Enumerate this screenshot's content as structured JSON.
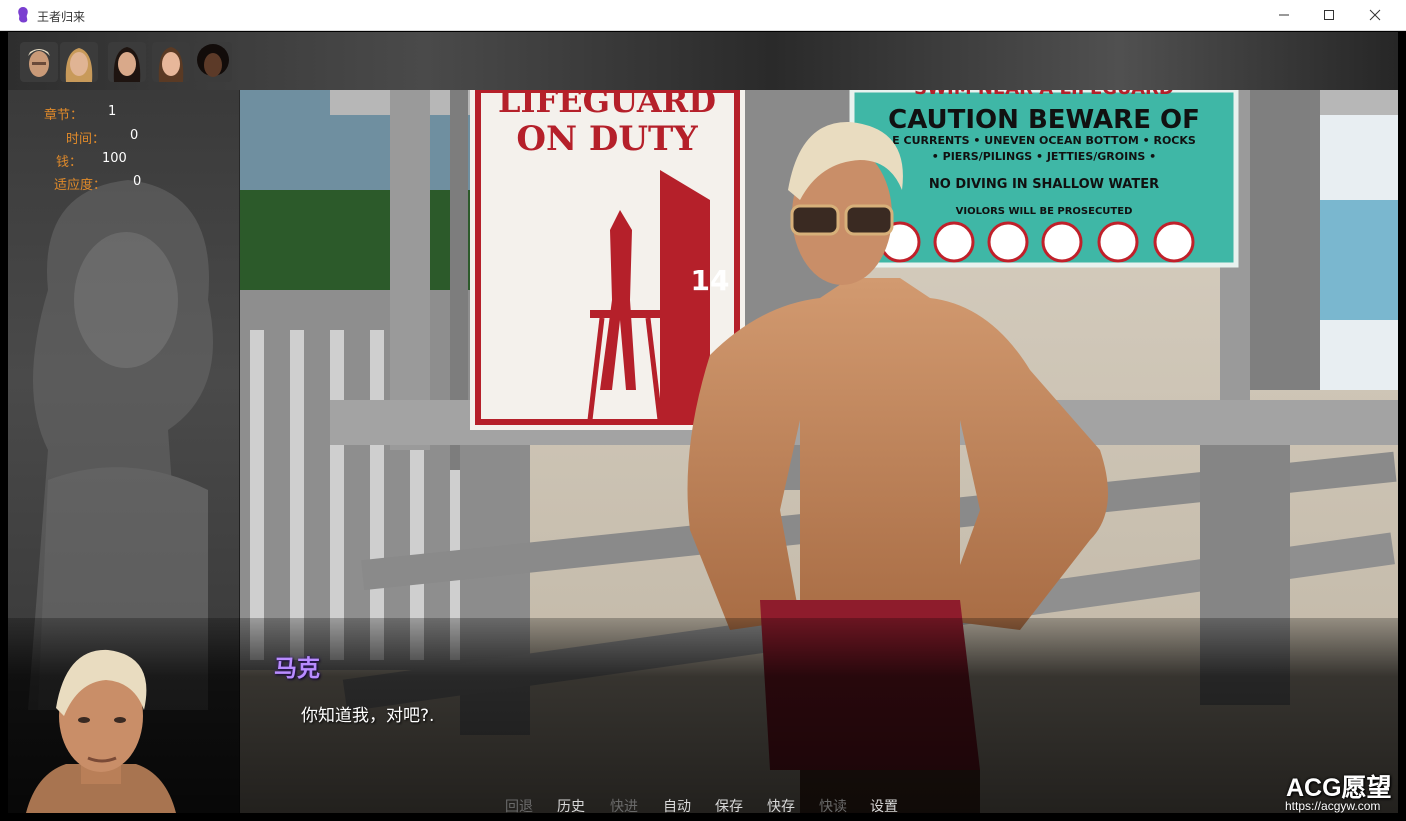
{
  "window": {
    "title": "王者归来"
  },
  "stats": [
    {
      "label": "章节：",
      "value": "1"
    },
    {
      "label": "时间：",
      "value": "0"
    },
    {
      "label": "钱：",
      "value": "100"
    },
    {
      "label": "适应度：",
      "value": "0"
    }
  ],
  "dialogue": {
    "speaker": "马克",
    "text": "你知道我，对吧?."
  },
  "quick_menu": [
    {
      "label": "回退",
      "enabled": false
    },
    {
      "label": "历史",
      "enabled": true
    },
    {
      "label": "快进",
      "enabled": false
    },
    {
      "label": "自动",
      "enabled": true
    },
    {
      "label": "保存",
      "enabled": true
    },
    {
      "label": "快存",
      "enabled": true
    },
    {
      "label": "快读",
      "enabled": false
    },
    {
      "label": "设置",
      "enabled": true
    }
  ],
  "scene": {
    "sign_left": {
      "line1": "LIFEGUARD",
      "line2": "ON DUTY",
      "number": "14"
    },
    "sign_right": {
      "top": "SWIM NEAR A LIFEGUARD",
      "heading": "CAUTION BEWARE OF",
      "row1": "E CURRENTS  •  UNEVEN OCEAN BOTTOM  •  ROCKS",
      "row2": "• PIERS/PILINGS • JETTIES/GROINS •",
      "row3": "NO DIVING IN SHALLOW WATER",
      "row4": "VIOLORS WILL BE PROSECUTED"
    }
  },
  "watermark": {
    "brand": "ACG愿望",
    "url": "https://acgyw.com"
  },
  "colors": {
    "stat_label": "#e08a2a",
    "speaker": "#b98cff",
    "sign_red": "#b5202a",
    "sign_teal": "#3fb7a6"
  }
}
